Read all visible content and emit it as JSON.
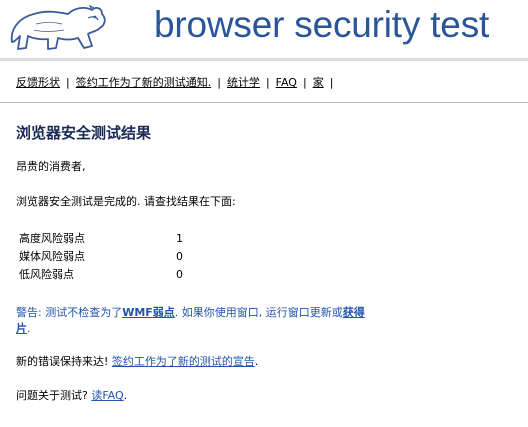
{
  "header": {
    "site_title": "browser security test"
  },
  "nav": {
    "items": [
      "反馈形状",
      "签约工作为了新的测试通知.",
      "统计学",
      "FAQ",
      "家"
    ]
  },
  "content": {
    "heading": "浏览器安全测试结果",
    "greeting": "昂贵的消费者,",
    "intro": "浏览器安全测试是完成的. 请查找结果在下面:",
    "results": [
      {
        "label": "高度风险弱点",
        "value": "1"
      },
      {
        "label": "媒体风险弱点",
        "value": "0"
      },
      {
        "label": "低风险弱点",
        "value": "0"
      }
    ],
    "warning": {
      "prefix": "警告: 测试不检查为了",
      "link1": "WMF弱点",
      "middle": ". 如果你使用窗口, 运行窗口更新或",
      "link2_part1": "获得",
      "link2_part2": "片",
      "suffix": "."
    },
    "bugs": {
      "prefix": "新的错误保持来达! ",
      "link": "签约工作为了新的测试的宣告",
      "suffix": "."
    },
    "questions": {
      "prefix": "问题关于测试? ",
      "link_part1": "读",
      "link_part2": "FAQ",
      "suffix": "."
    }
  }
}
